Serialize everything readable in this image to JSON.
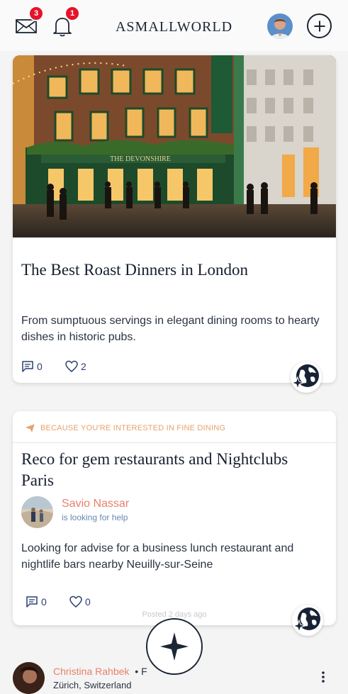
{
  "header": {
    "logo": "ASMALLWORLD",
    "messages_badge": "3",
    "notifications_badge": "1",
    "icons": [
      "envelope-icon",
      "bell-icon",
      "profile-avatar",
      "plus-icon"
    ]
  },
  "feed": [
    {
      "title": "The Best Roast Dinners in London",
      "description": "From sumptuous servings in elegant dining rooms to hearty dishes in historic pubs.",
      "comments": "0",
      "likes": "2",
      "photo_sign": "THE DEVONSHIRE"
    },
    {
      "label": "BECAUSE YOU'RE INTERESTED IN FINE DINING",
      "title": "Reco for gem restaurants and Nightclubs Paris",
      "author_name": "Savio Nassar",
      "author_status": "is looking for help",
      "description": "Looking for advise for a business lunch restaurant and nightlife bars nearby Neuilly-sur-Seine",
      "comments": "0",
      "likes": "0",
      "posted": "Posted 2 days ago"
    }
  ],
  "next_post": {
    "author_name": "Christina Rahbek",
    "separator": "• F",
    "location": "Zürich, Switzerland"
  },
  "colors": {
    "accent": "#e8816a",
    "badge": "#e5132b",
    "navy": "#1c2634"
  }
}
